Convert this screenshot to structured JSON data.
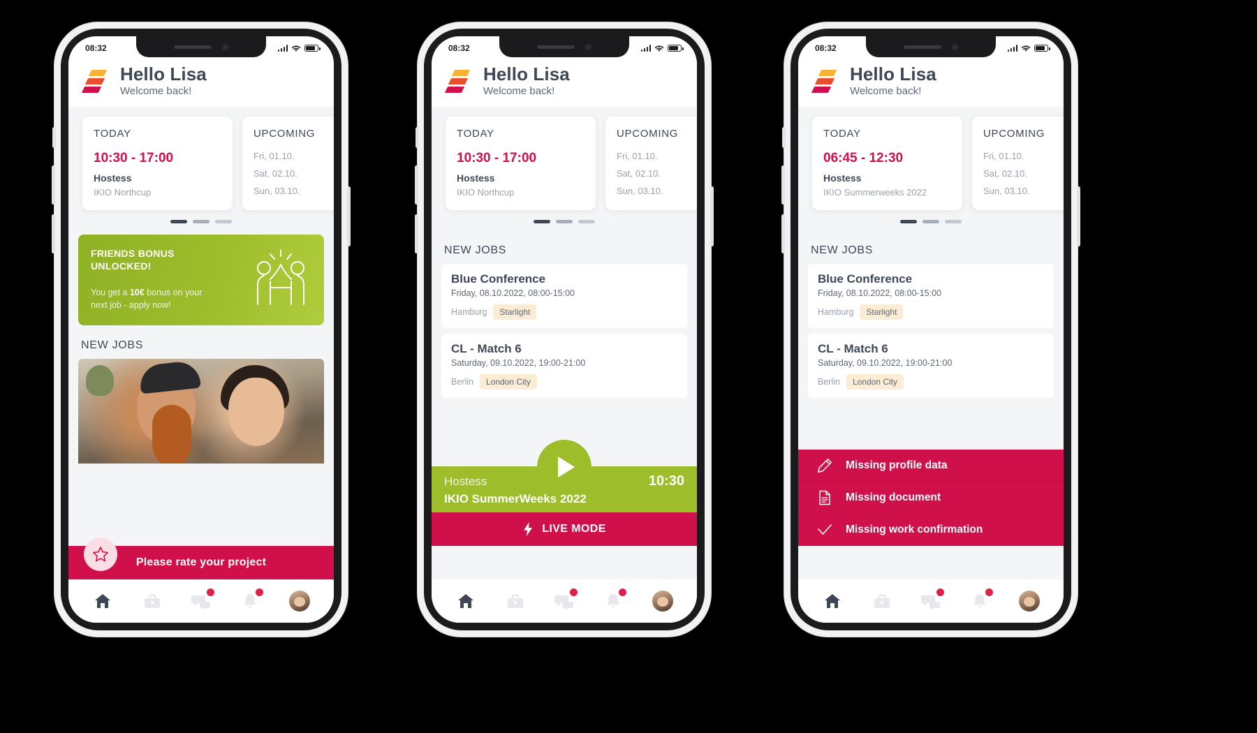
{
  "app": {
    "status_bar": {
      "time": "08:32",
      "signal_icon": "signal-bars-icon",
      "wifi_icon": "wifi-icon",
      "battery_icon": "battery-icon"
    },
    "header": {
      "greeting": "Hello Lisa",
      "subtitle": "Welcome back!",
      "logo_icon": "app-logo-icon"
    },
    "brand_colors": {
      "primary_red": "#d0104a",
      "green": "#9dbd2b",
      "dark_text": "#3e4756",
      "muted_text": "#9aa1ae",
      "tag_bg": "#fbecd4",
      "bg": "#f4f5f7"
    }
  },
  "screen1": {
    "today_card": {
      "label": "TODAY",
      "time": "10:30 - 17:00",
      "role": "Hostess",
      "project": "IKIO Northcup"
    },
    "upcoming_card": {
      "label": "UPCOMING",
      "lines": [
        "Fri, 01.10.",
        "Sat, 02.10.",
        "Sun, 03.10."
      ]
    },
    "pager": {
      "total": 3,
      "active": 1
    },
    "bonus": {
      "title": "FRIENDS BONUS UNLOCKED!",
      "body_pre": "You get a ",
      "body_amount": "10€",
      "body_post": " bonus on your next job - apply now!",
      "illustration_icon": "high-five-people-icon"
    },
    "new_jobs_title": "NEW JOBS",
    "photo_icon": "job-photo-image",
    "rate_bar": {
      "label": "Please rate your project",
      "icon": "star-icon"
    }
  },
  "screen2": {
    "today_card": {
      "label": "TODAY",
      "time": "10:30 - 17:00",
      "role": "Hostess",
      "project": "IKIO Northcup"
    },
    "upcoming_card": {
      "label": "UPCOMING",
      "lines": [
        "Fri, 01.10.",
        "Sat, 02.10.",
        "Sun, 03.10."
      ]
    },
    "pager": {
      "total": 3,
      "active": 1
    },
    "new_jobs_title": "NEW JOBS",
    "jobs": [
      {
        "title": "Blue Conference",
        "date": "Friday, 08.10.2022, 08:00-15:00",
        "city": "Hamburg",
        "tag": "Starlight"
      },
      {
        "title": "CL - Match 6",
        "date": "Saturday, 09.10.2022, 19:00-21:00",
        "city": "Berlin",
        "tag": "London City"
      }
    ],
    "live_banner": {
      "role": "Hostess",
      "time": "10:30",
      "project": "IKIO SummerWeeks 2022",
      "play_icon": "play-icon"
    },
    "live_mode": {
      "label": "LIVE MODE",
      "icon": "lightning-bolt-icon"
    }
  },
  "screen3": {
    "today_card": {
      "label": "TODAY",
      "time": "06:45 - 12:30",
      "role": "Hostess",
      "project": "IKIO Summerweeks 2022"
    },
    "upcoming_card": {
      "label": "UPCOMING",
      "lines": [
        "Fri, 01.10.",
        "Sat, 02.10.",
        "Sun, 03.10."
      ]
    },
    "pager": {
      "total": 3,
      "active": 1
    },
    "new_jobs_title": "NEW JOBS",
    "jobs": [
      {
        "title": "Blue Conference",
        "date": "Friday, 08.10.2022, 08:00-15:00",
        "city": "Hamburg",
        "tag": "Starlight"
      },
      {
        "title": "CL - Match 6",
        "date": "Saturday, 09.10.2022, 19:00-21:00",
        "city": "Berlin",
        "tag": "London City"
      }
    ],
    "alerts": [
      {
        "label": "Missing profile data",
        "icon": "pencil-icon"
      },
      {
        "label": "Missing document",
        "icon": "document-icon"
      },
      {
        "label": "Missing work confirmation",
        "icon": "check-icon"
      }
    ]
  },
  "tabbar": {
    "items": [
      {
        "name": "home",
        "icon": "home-icon",
        "active": true,
        "badge": false
      },
      {
        "name": "jobs",
        "icon": "briefcase-icon",
        "active": false,
        "badge": false
      },
      {
        "name": "messages",
        "icon": "chat-bubbles-icon",
        "active": false,
        "badge": true
      },
      {
        "name": "notifications",
        "icon": "bell-icon",
        "active": false,
        "badge": true
      },
      {
        "name": "profile",
        "icon": "avatar-icon",
        "active": false,
        "badge": false
      }
    ]
  }
}
